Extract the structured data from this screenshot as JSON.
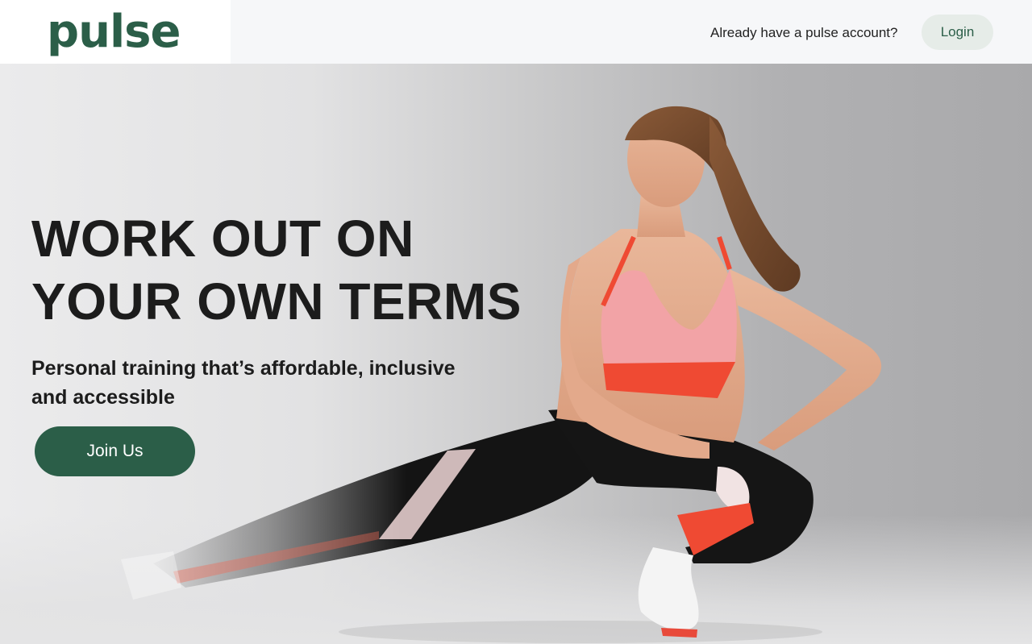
{
  "header": {
    "logo_text": "pulse",
    "account_prompt": "Already have a pulse account?",
    "login_label": "Login"
  },
  "hero": {
    "headline_line1": "WORK OUT ON",
    "headline_line2": "YOUR OWN TERMS",
    "subheadline": "Personal training that’s affordable, inclusive and accessible",
    "cta_label": "Join Us"
  },
  "colors": {
    "brand_green": "#2b5e48",
    "login_bg": "#e6ece8",
    "topbar_bg": "#f6f7f9"
  }
}
